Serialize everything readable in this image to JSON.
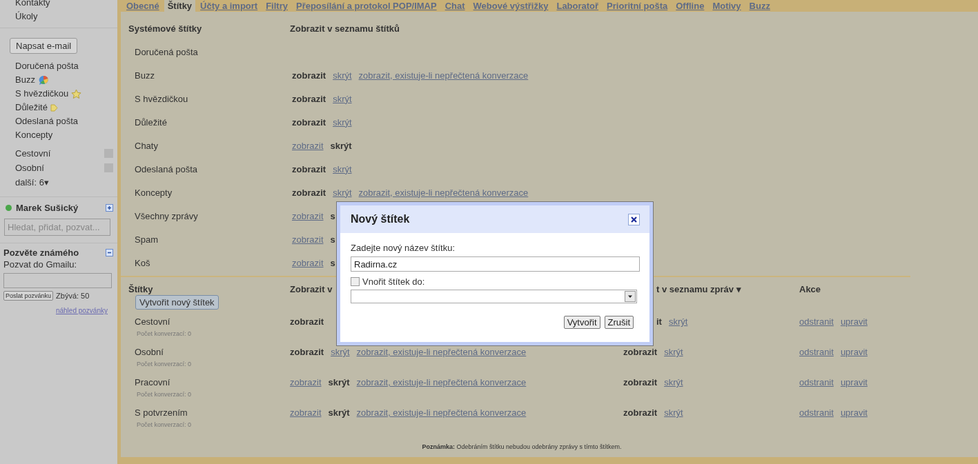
{
  "sidebar": {
    "top_links": [
      "Kontakty",
      "Úkoly"
    ],
    "compose_button": "Napsat e-mail",
    "folders": [
      {
        "label": "Doručená pošta",
        "kind": "plain"
      },
      {
        "label": "Buzz",
        "kind": "buzz"
      },
      {
        "label": "S hvězdičkou",
        "kind": "star"
      },
      {
        "label": "Důležité",
        "kind": "important"
      },
      {
        "label": "Odeslaná pošta",
        "kind": "plain"
      },
      {
        "label": "Koncepty",
        "kind": "plain"
      }
    ],
    "labels": [
      "Cestovní",
      "Osobní"
    ],
    "more": "další: 6▾",
    "chat": {
      "name": "Marek Sušický",
      "search_placeholder": "Hledat, přidat, pozvat..."
    },
    "invite": {
      "title": "Pozvěte známého",
      "prompt": "Pozvat do Gmailu:",
      "send_button": "Poslat pozvánku",
      "remaining": "Zbývá: 50",
      "preview_link": "náhled pozvánky"
    }
  },
  "tabs": [
    {
      "label": "Obecné",
      "selected": false
    },
    {
      "label": "Štítky",
      "selected": true
    },
    {
      "label": "Účty a import",
      "selected": false
    },
    {
      "label": "Filtry",
      "selected": false
    },
    {
      "label": "Přeposílání a protokol POP/IMAP",
      "selected": false
    },
    {
      "label": "Chat",
      "selected": false
    },
    {
      "label": "Webové výstřižky",
      "selected": false
    },
    {
      "label": "Laboratoř",
      "selected": false
    },
    {
      "label": "Prioritní pošta",
      "selected": false
    },
    {
      "label": "Offline",
      "selected": false
    },
    {
      "label": "Motivy",
      "selected": false
    },
    {
      "label": "Buzz",
      "selected": false
    }
  ],
  "system_labels": {
    "header_name": "Systémové štítky",
    "header_show": "Zobrazit v seznamu štítků",
    "rows": [
      {
        "name": "Doručená pošta",
        "options": []
      },
      {
        "name": "Buzz",
        "options": [
          {
            "text": "zobrazit",
            "selected": true
          },
          {
            "text": "skrýt",
            "selected": false
          },
          {
            "text": "zobrazit, existuje-li nepřečtená konverzace",
            "selected": false
          }
        ]
      },
      {
        "name": "S hvězdičkou",
        "options": [
          {
            "text": "zobrazit",
            "selected": true
          },
          {
            "text": "skrýt",
            "selected": false
          }
        ]
      },
      {
        "name": "Důležité",
        "options": [
          {
            "text": "zobrazit",
            "selected": true
          },
          {
            "text": "skrýt",
            "selected": false
          }
        ]
      },
      {
        "name": "Chaty",
        "options": [
          {
            "text": "zobrazit",
            "selected": false
          },
          {
            "text": "skrýt",
            "selected": true
          }
        ]
      },
      {
        "name": "Odeslaná pošta",
        "options": [
          {
            "text": "zobrazit",
            "selected": true
          },
          {
            "text": "skrýt",
            "selected": false
          }
        ]
      },
      {
        "name": "Koncepty",
        "options": [
          {
            "text": "zobrazit",
            "selected": true
          },
          {
            "text": "skrýt",
            "selected": false
          },
          {
            "text": "zobrazit, existuje-li nepřečtená konverzace",
            "selected": false
          }
        ]
      },
      {
        "name": "Všechny zprávy",
        "options": [
          {
            "text": "zobrazit",
            "selected": false
          },
          {
            "text": "s",
            "selected": true
          }
        ]
      },
      {
        "name": "Spam",
        "options": [
          {
            "text": "zobrazit",
            "selected": false
          },
          {
            "text": "s",
            "selected": true
          }
        ]
      },
      {
        "name": "Koš",
        "options": [
          {
            "text": "zobrazit",
            "selected": false
          },
          {
            "text": "s",
            "selected": true
          }
        ]
      }
    ]
  },
  "user_labels": {
    "header_name": "Štítky",
    "header_show_labels": "Zobrazit v",
    "header_show_messages": "t v seznamu zpráv ▾",
    "header_actions": "Akce",
    "create_button": "Vytvořit nový štítek",
    "rows": [
      {
        "name": "Cestovní",
        "count": "Počet konverzací: 0",
        "label_options": [
          {
            "text": "zobrazit",
            "selected": true
          }
        ],
        "message_options": [
          {
            "text": "it",
            "selected": true
          },
          {
            "text": "skrýt",
            "selected": false
          }
        ],
        "actions": [
          "odstranit",
          "upravit"
        ]
      },
      {
        "name": "Osobní",
        "count": "Počet konverzací: 0",
        "label_options": [
          {
            "text": "zobrazit",
            "selected": true
          },
          {
            "text": "skrýt",
            "selected": false
          },
          {
            "text": "zobrazit, existuje-li nepřečtená konverzace",
            "selected": false
          }
        ],
        "message_options": [
          {
            "text": "zobrazit",
            "selected": true
          },
          {
            "text": "skrýt",
            "selected": false
          }
        ],
        "actions": [
          "odstranit",
          "upravit"
        ]
      },
      {
        "name": "Pracovní",
        "count": "Počet konverzací: 0",
        "label_options": [
          {
            "text": "zobrazit",
            "selected": false
          },
          {
            "text": "skrýt",
            "selected": true
          },
          {
            "text": "zobrazit, existuje-li nepřečtená konverzace",
            "selected": false
          }
        ],
        "message_options": [
          {
            "text": "zobrazit",
            "selected": true
          },
          {
            "text": "skrýt",
            "selected": false
          }
        ],
        "actions": [
          "odstranit",
          "upravit"
        ]
      },
      {
        "name": "S potvrzením",
        "count": "Počet konverzací: 0",
        "label_options": [
          {
            "text": "zobrazit",
            "selected": false
          },
          {
            "text": "skrýt",
            "selected": true
          },
          {
            "text": "zobrazit, existuje-li nepřečtená konverzace",
            "selected": false
          }
        ],
        "message_options": [
          {
            "text": "zobrazit",
            "selected": true
          },
          {
            "text": "skrýt",
            "selected": false
          }
        ],
        "actions": [
          "odstranit",
          "upravit"
        ]
      }
    ],
    "note": "**Poznámka:** Odebráním štítku nebudou odebrány zprávy s tímto štítkem."
  },
  "dialog": {
    "title": "Nový štítek",
    "field_label": "Zadejte nový název štítku:",
    "field_value": "Radirna.cz",
    "nest": {
      "label": "Vnořit štítek do:",
      "checked": false
    },
    "buttons": [
      "Vytvořit",
      "Zrušit"
    ]
  }
}
